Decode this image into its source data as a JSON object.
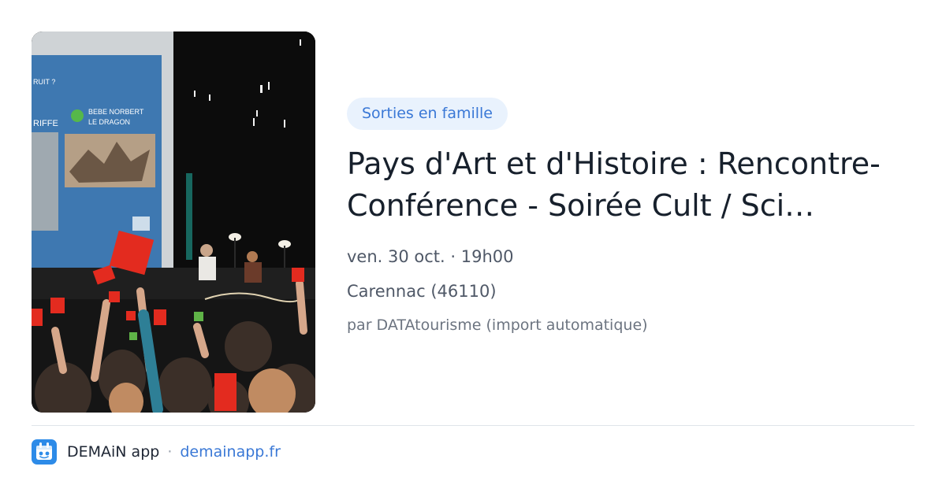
{
  "card": {
    "category": "Sorties en famille",
    "title_line1": "Pays d'Art et d'Histoire : Rencontre-",
    "title_line2": "Conférence - Soirée Cult / Sci…",
    "date_time": "ven. 30 oct. · 19h00",
    "location": "Carennac (46110)",
    "source": "par DATAtourisme (import automatique)"
  },
  "photo": {
    "screen_text": {
      "top_left": "RUIT ?",
      "left_word": "RIFFE",
      "label_line1": "BEBE NORBERT",
      "label_line2": "LE DRAGON"
    }
  },
  "footer": {
    "app_name": "DEMAiN app",
    "separator": "·",
    "link": "demainapp.fr",
    "icon": "demain-app-icon"
  },
  "colors": {
    "accent": "#3a78d6",
    "pill_background": "#e9f2fd",
    "title": "#17202c",
    "meta": "#4f5867",
    "divider": "#dfe4ea"
  }
}
